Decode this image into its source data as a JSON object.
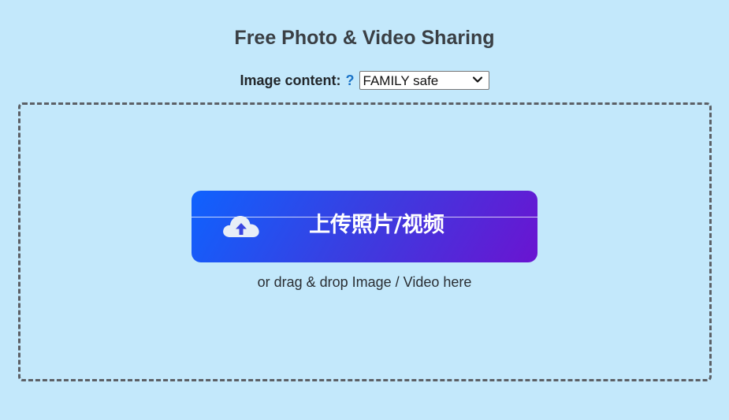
{
  "header": {
    "title": "Free Photo & Video Sharing"
  },
  "content_filter": {
    "label": "Image content:",
    "help": "?",
    "selected": "FAMILY safe"
  },
  "upload": {
    "button_label": "上传照片/视频",
    "icon": "cloud-upload-icon",
    "drag_hint": "or drag & drop Image / Video here"
  },
  "colors": {
    "background": "#c3e8fb",
    "button_gradient_start": "#0f62fe",
    "button_gradient_end": "#6a14d1",
    "help_link": "#1a73c8",
    "dashed_border": "#5c6066"
  }
}
